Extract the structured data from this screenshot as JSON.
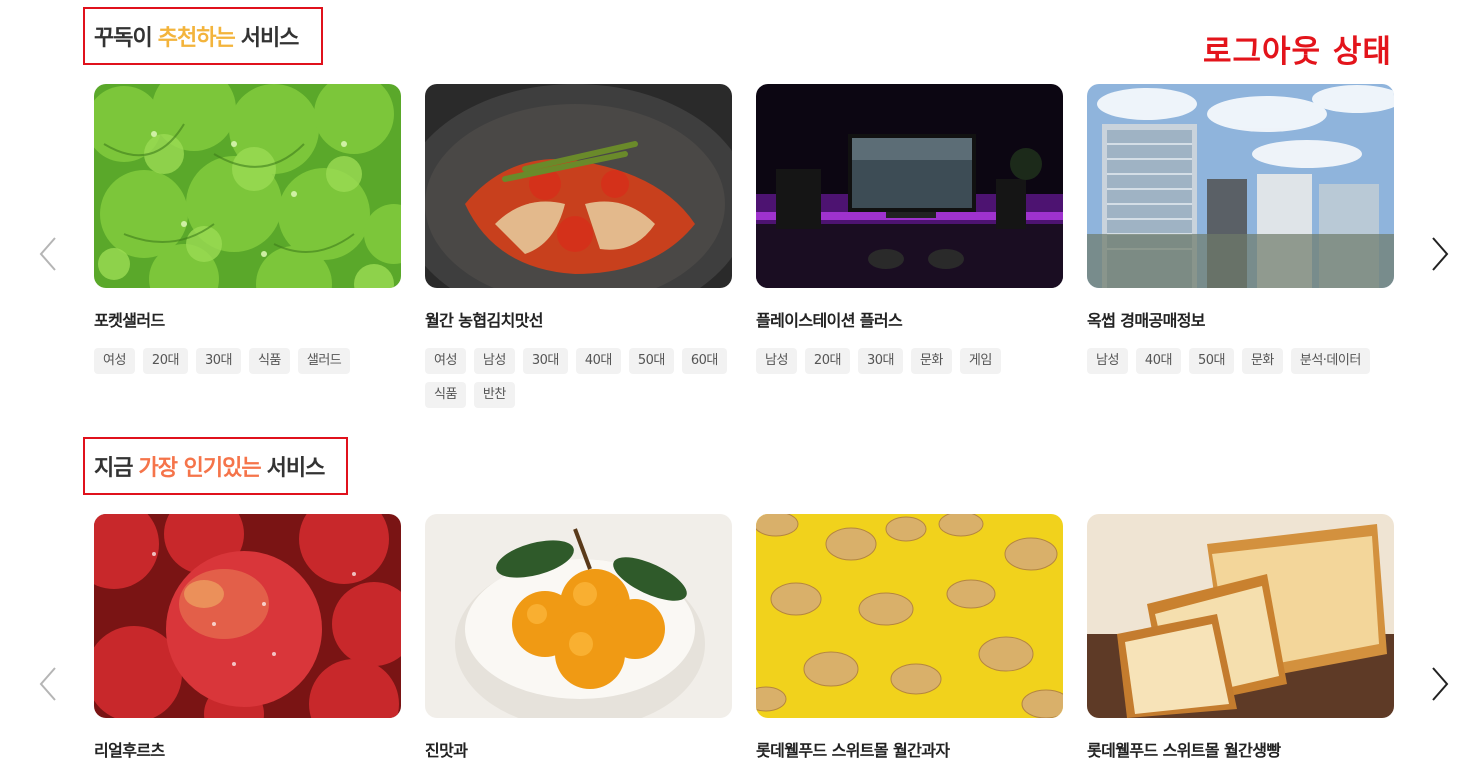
{
  "annotation": {
    "status_label": "로그아웃 상태"
  },
  "recommended": {
    "title_prefix": "꾸독이",
    "title_highlight": "추천하는",
    "title_suffix": "서비스",
    "cards": [
      {
        "name": "포켓샐러드",
        "image": "lettuce",
        "tags": [
          "여성",
          "20대",
          "30대",
          "식품",
          "샐러드"
        ]
      },
      {
        "name": "월간 농협김치맛선",
        "image": "kimchi",
        "tags": [
          "여성",
          "남성",
          "30대",
          "40대",
          "50대",
          "60대",
          "식품",
          "반찬"
        ]
      },
      {
        "name": "플레이스테이션 플러스",
        "image": "gaming-setup",
        "tags": [
          "남성",
          "20대",
          "30대",
          "문화",
          "게임"
        ]
      },
      {
        "name": "옥썹 경매공매정보",
        "image": "city-buildings",
        "tags": [
          "남성",
          "40대",
          "50대",
          "문화",
          "분석·데이터"
        ]
      }
    ]
  },
  "popular": {
    "title_prefix": "지금",
    "title_highlight": "가장 인기있는",
    "title_suffix": "서비스",
    "cards": [
      {
        "name": "리얼후르츠",
        "image": "apples",
        "tags": []
      },
      {
        "name": "진맛과",
        "image": "persimmons",
        "tags": []
      },
      {
        "name": "롯데웰푸드 스위트몰 월간과자",
        "image": "chips",
        "tags": []
      },
      {
        "name": "롯데웰푸드 스위트몰 월간생빵",
        "image": "bread",
        "tags": []
      }
    ]
  },
  "icons": {
    "prev": "chevron-left-icon",
    "next": "chevron-right-icon"
  },
  "colors": {
    "annotation_red": "#e3141b",
    "highlight_yellow": "#f3b43c",
    "highlight_orange": "#f5744a"
  }
}
